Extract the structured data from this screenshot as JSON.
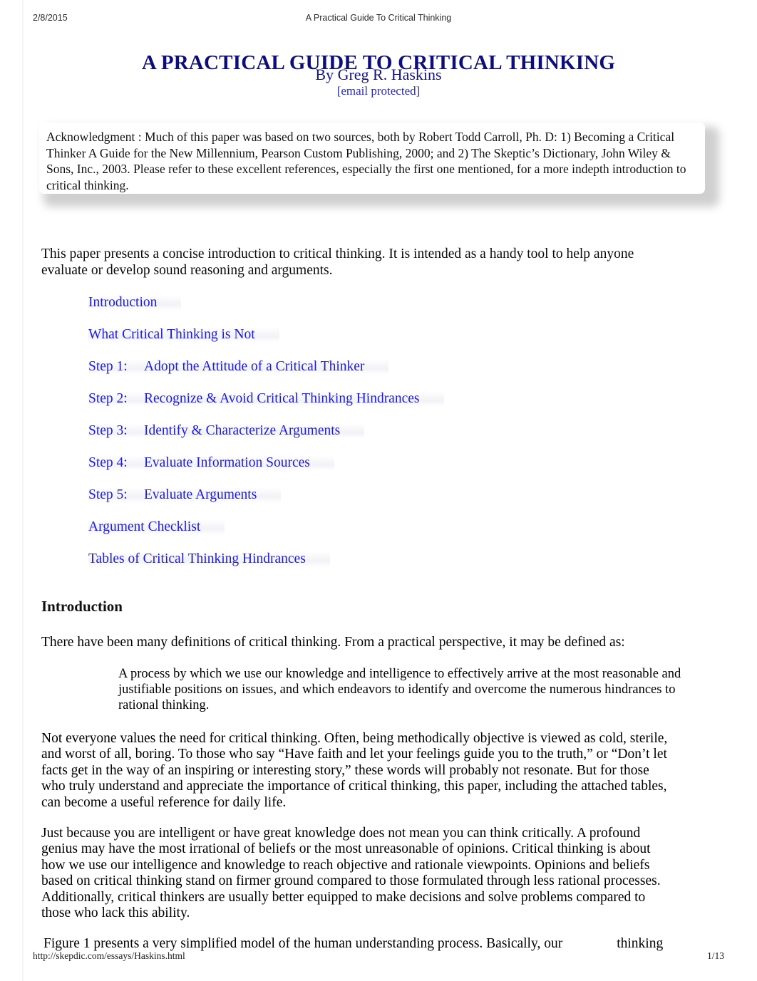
{
  "print_header": {
    "date": "2/8/2015",
    "title": "A Practical Guide To Critical Thinking"
  },
  "document": {
    "title": "A PRACTICAL GUIDE TO CRITICAL THINKING",
    "author": "By Greg R. Haskins",
    "email": "[email protected]",
    "acknowledgment": "Acknowledgment : Much of this paper was based on two sources, both by Robert Todd Carroll, Ph. D: 1) Becoming a Critical Thinker  A Guide for the New Millennium, Pearson Custom Publishing, 2000; and 2) The Skeptic’s Dictionary, John Wiley & Sons, Inc., 2003. Please refer to these excellent references, especially the first one mentioned, for a more indepth introduction to critical thinking.",
    "intro_paragraph": "This paper presents a concise introduction to critical thinking. It is intended as a handy tool to help anyone evaluate or develop sound reasoning and arguments."
  },
  "toc": {
    "items": [
      {
        "step": "",
        "label": "Introduction"
      },
      {
        "step": "",
        "label": "What Critical Thinking is Not"
      },
      {
        "step": "Step 1:",
        "label": "Adopt the Attitude of a Critical Thinker"
      },
      {
        "step": "Step 2:",
        "label": "Recognize & Avoid Critical Thinking Hindrances"
      },
      {
        "step": "Step 3:",
        "label": "Identify & Characterize Arguments"
      },
      {
        "step": "Step 4:",
        "label": "Evaluate Information Sources"
      },
      {
        "step": "Step 5:",
        "label": "Evaluate Arguments"
      },
      {
        "step": "",
        "label": "Argument Checklist"
      },
      {
        "step": "",
        "label": "Tables of  Critical Thinking Hindrances"
      }
    ]
  },
  "section": {
    "heading": "Introduction",
    "paragraph_1": "There have been many definitions of critical thinking. From a practical perspective, it may be defined as:",
    "definition_quote": "A process by which we use our knowledge and intelligence to effectively arrive at the most reasonable and justifiable positions on issues, and which endeavors to identify and overcome the numerous hindrances to rational thinking.",
    "paragraph_2": "Not everyone values the need for critical thinking. Often, being methodically objective is viewed as cold, sterile, and worst of all, boring. To those who say “Have faith and let your feelings guide you to the truth,” or “Don’t let facts get in the way of an inspiring or interesting story,” these words will probably not resonate. But for those who truly understand and appreciate the importance of critical thinking, this paper, including the attached tables, can become a useful reference for daily life.",
    "paragraph_3": "Just because you are intelligent or have great knowledge does not mean you can think critically. A profound genius may have the most irrational of beliefs or the most unreasonable of opinions. Critical thinking is about  how  we use our intelligence and knowledge to reach objective and rationale viewpoints. Opinions and beliefs based on critical thinking stand on firmer ground compared to those formulated through less rational processes. Additionally, critical thinkers are usually better equipped to make decisions and solve problems compared to those who lack this ability.",
    "paragraph_4_start": "Figure 1 presents a very simplified model of the human understanding process. Basically, our",
    "paragraph_4_end": "thinking"
  },
  "print_footer": {
    "url": "http://skepdic.com/essays/Haskins.html",
    "page": "1/13"
  },
  "colors": {
    "title_navy": "#0e0e7a",
    "link_blue": "#1c1ce0",
    "body_text": "#0a0a0a",
    "page_background": "#ffffff"
  }
}
